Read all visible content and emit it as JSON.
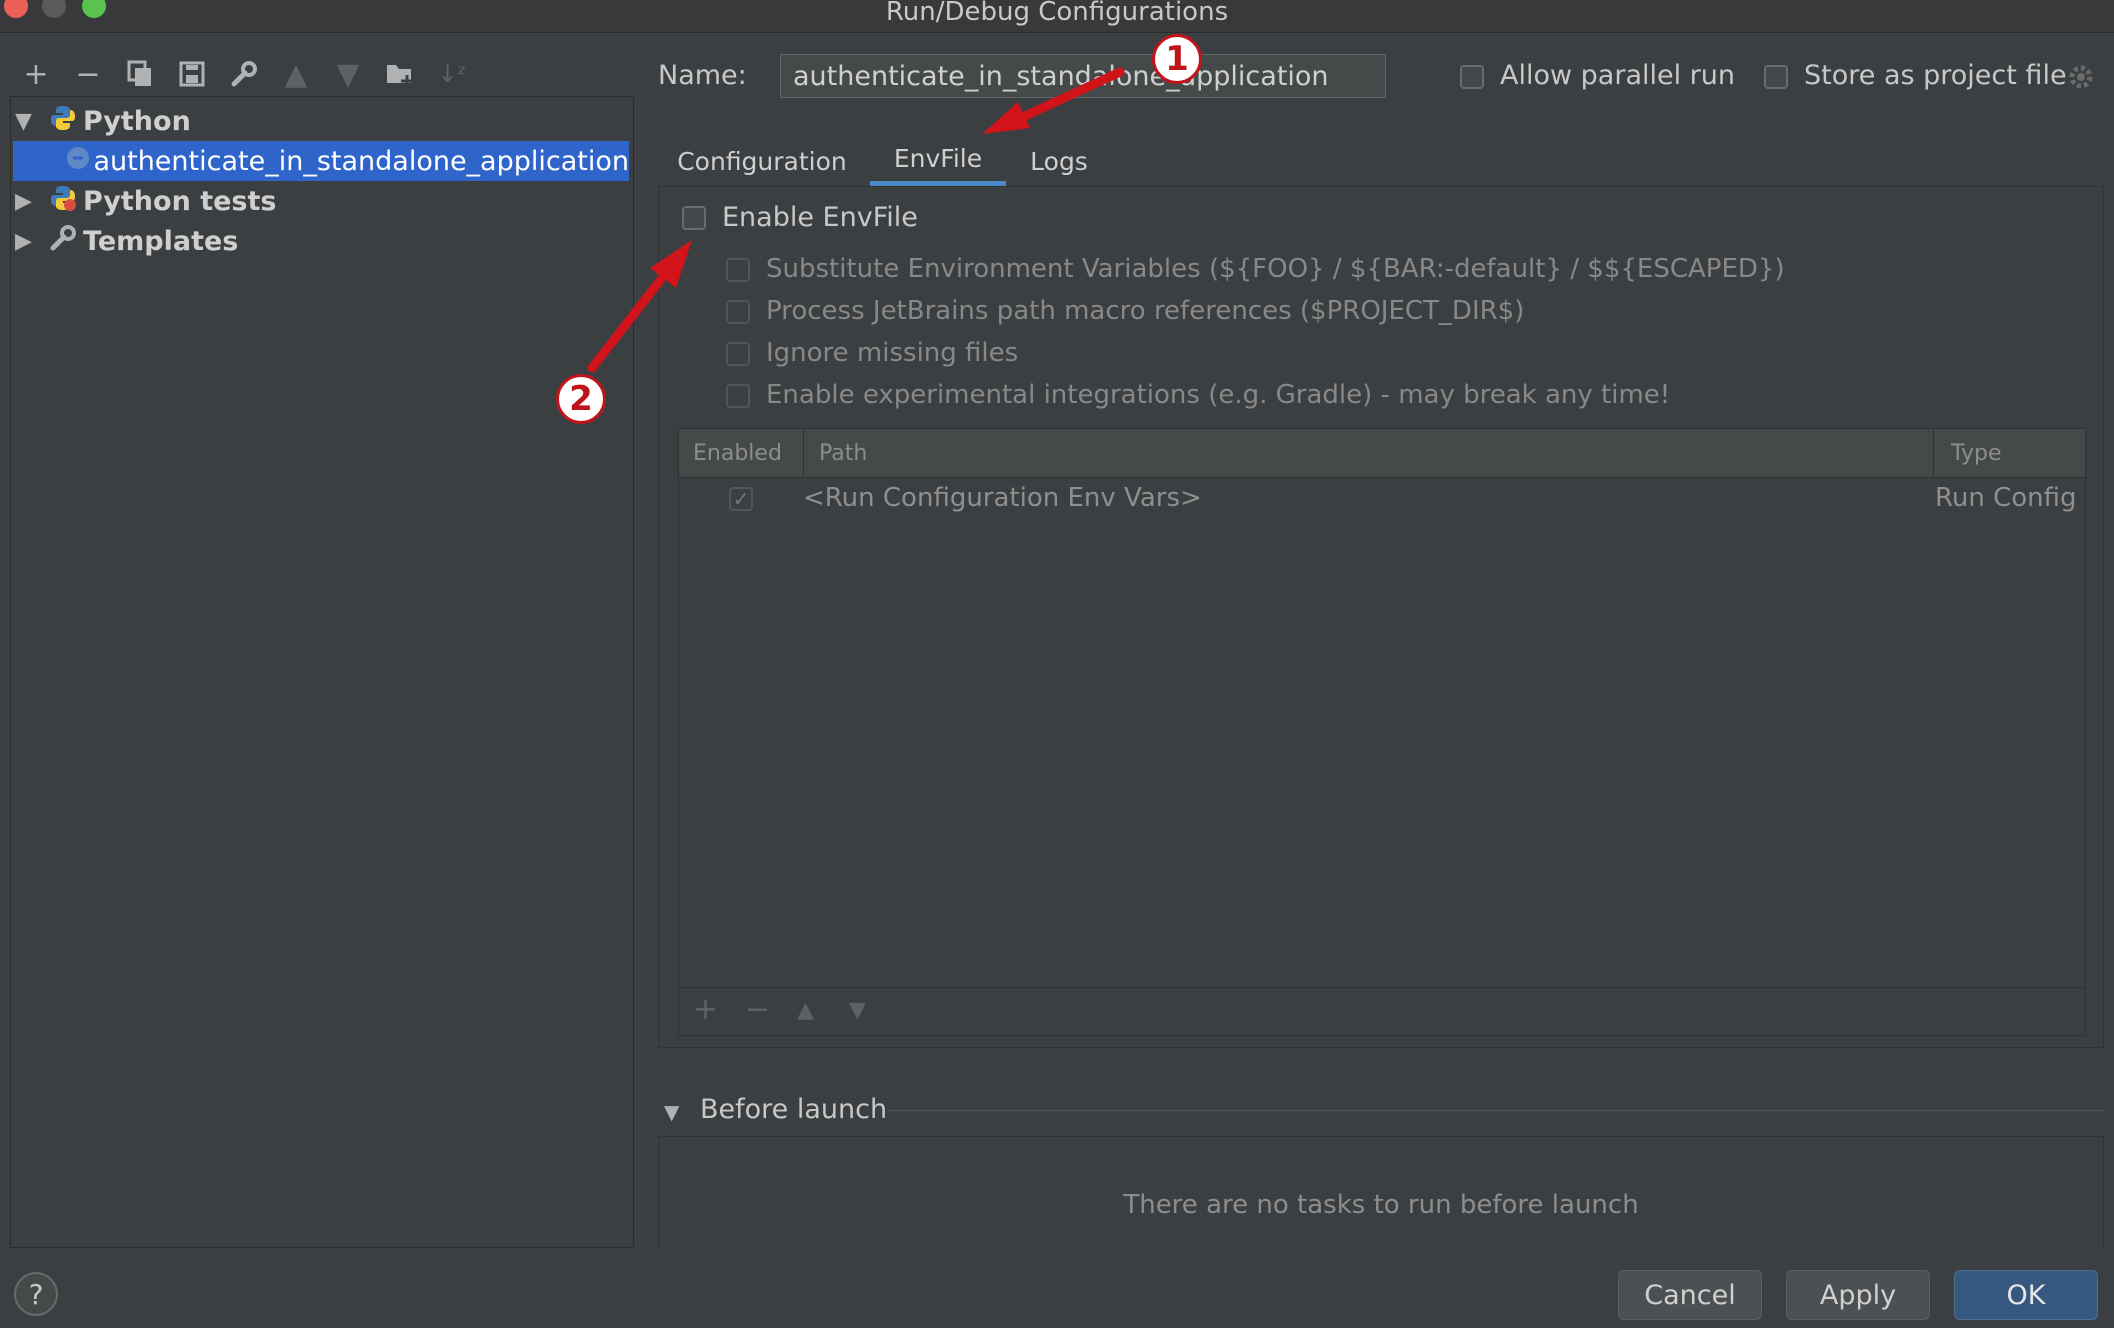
{
  "window": {
    "title": "Run/Debug Configurations"
  },
  "colors": {
    "accent": "#2f65ca",
    "tab_underline": "#4a88c7",
    "ok_button": "#365880",
    "annotation": "#c0141a"
  },
  "toolbar": {
    "icons": [
      "plus-icon",
      "minus-icon",
      "copy-icon",
      "save-icon",
      "wrench-icon",
      "arrow-up-icon",
      "arrow-down-icon",
      "folder-add-icon",
      "sort-icon"
    ]
  },
  "tree": {
    "python": "Python",
    "selected": "authenticate_in_standalone_application",
    "python_tests": "Python tests",
    "templates": "Templates"
  },
  "header": {
    "name_label": "Name:",
    "name_value": "authenticate_in_standalone_application",
    "allow_parallel": "Allow parallel run",
    "store_project": "Store as project file"
  },
  "tabs": [
    {
      "label": "Configuration"
    },
    {
      "label": "EnvFile"
    },
    {
      "label": "Logs"
    }
  ],
  "envfile": {
    "enable": "Enable EnvFile",
    "options": [
      "Substitute Environment Variables (${FOO} / ${BAR:-default} / $${ESCAPED})",
      "Process JetBrains path macro references ($PROJECT_DIR$)",
      "Ignore missing files",
      "Enable experimental integrations (e.g. Gradle) - may break any time!"
    ],
    "table": {
      "headers": [
        "Enabled",
        "Path",
        "Type"
      ],
      "rows": [
        {
          "path": "<Run Configuration Env Vars>",
          "type": "Run Config"
        }
      ]
    }
  },
  "before_launch": {
    "title": "Before launch",
    "empty": "There are no tasks to run before launch"
  },
  "buttons": {
    "cancel": "Cancel",
    "apply": "Apply",
    "ok": "OK",
    "help": "?"
  },
  "annotations": {
    "one": "1",
    "two": "2"
  }
}
